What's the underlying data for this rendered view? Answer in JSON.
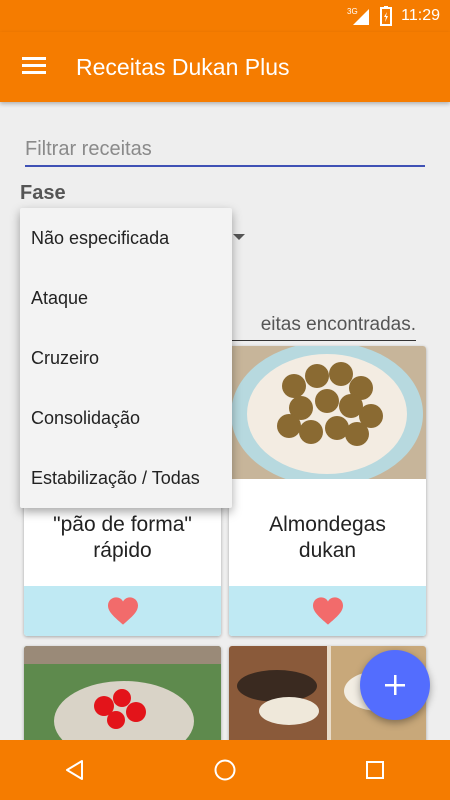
{
  "status_bar": {
    "network": "3G",
    "time": "11:29"
  },
  "app_bar": {
    "title": "Receitas Dukan Plus",
    "menu_icon": "hamburger-menu-icon"
  },
  "filter": {
    "placeholder": "Filtrar receitas",
    "value": ""
  },
  "phase": {
    "label": "Fase",
    "options": [
      "Não especificada",
      "Ataque",
      "Cruzeiro",
      "Consolidação",
      "Estabilização / Todas"
    ]
  },
  "results": {
    "text": "eitas encontradas."
  },
  "recipes": [
    {
      "title": "\"pão de forma\" rápido",
      "favorite_icon": "heart-icon"
    },
    {
      "title": "Almondegas dukan",
      "favorite_icon": "heart-icon"
    }
  ],
  "fab": {
    "icon": "plus-icon"
  },
  "colors": {
    "primary": "#f57c00",
    "accent": "#536dfe",
    "favorite_bg": "#bfe9f3",
    "heart": "#f26b6b"
  }
}
